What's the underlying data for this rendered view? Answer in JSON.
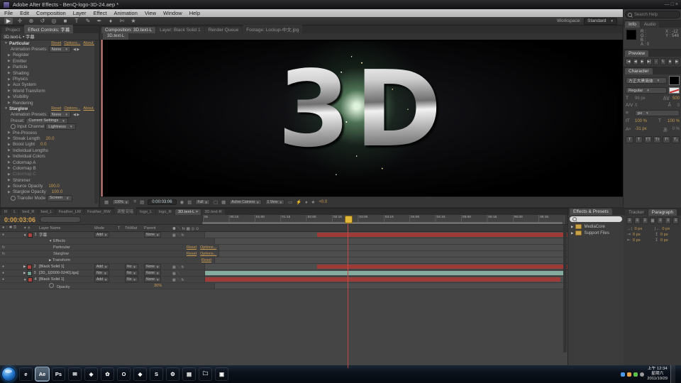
{
  "icons": {
    "expander_closed": "▶",
    "expander_open": "▼",
    "caret": "▼",
    "prev_next": "◀ ▶",
    "x_close": "×",
    "lock": "a",
    "eye": "●",
    "fx": "fx",
    "plus_target": "+"
  },
  "window": {
    "title": "Adobe After Effects - BenQ-logo-3D-24.aep *",
    "menus": [
      "File",
      "Edit",
      "Composition",
      "Layer",
      "Effect",
      "Animation",
      "View",
      "Window",
      "Help"
    ],
    "win_buttons": "—  □  ×"
  },
  "toolbar": {
    "tools": [
      {
        "g": "▶",
        "cls": "sel"
      },
      {
        "g": "✛"
      },
      {
        "g": "⊕"
      },
      {
        "g": "↺"
      },
      {
        "g": "◎"
      },
      {
        "g": "■"
      },
      {
        "g": "T"
      },
      {
        "g": "✎"
      },
      {
        "g": "✒"
      },
      {
        "g": "♦"
      },
      {
        "g": "✄"
      },
      {
        "g": "★"
      }
    ],
    "workspace_label": "Workspace:",
    "workspace_value": "Standard"
  },
  "search_help": {
    "placeholder": "Search Help"
  },
  "effect_controls": {
    "tabs": [
      {
        "label": "Project"
      },
      {
        "label": "Effect Controls: 字幕",
        "cls": "active"
      }
    ],
    "target": "3D.text-L • 字幕",
    "particular": {
      "name": "Particular",
      "links": [
        "Reset",
        "Options...",
        "About..."
      ],
      "anim_label": "Animation Presets:",
      "anim_value": "None",
      "groups": [
        "Register",
        "Emitter",
        "Particle",
        "Shading",
        "Physics",
        "Aux System",
        "World Transform",
        "Visibility",
        "Rendering"
      ]
    },
    "starglow": {
      "name": "Starglow",
      "links": [
        "Reset",
        "Options...",
        "About..."
      ],
      "anim_label": "Animation Presets:",
      "anim_value": "None",
      "preset_label": "Preset:",
      "preset_value": "Current Settings",
      "input_label": "Input Channel",
      "input_value": "Lightness",
      "rows": [
        {
          "label": "Pre-Process",
          "type": "group"
        },
        {
          "label": "Streak Length",
          "val": "20.0",
          "type": "val"
        },
        {
          "label": "Boost Light",
          "val": "0.0",
          "type": "val"
        },
        {
          "label": "Individual Lengths",
          "type": "group"
        },
        {
          "label": "Individual Colors",
          "type": "group"
        },
        {
          "label": "Colormap A",
          "type": "group"
        },
        {
          "label": "Colormap B",
          "type": "group"
        },
        {
          "label": "Colormap C",
          "type": "group",
          "cls": "dimrow"
        },
        {
          "label": "Shimmer",
          "type": "group"
        },
        {
          "label": "Source Opacity",
          "val": "100.0",
          "type": "val"
        },
        {
          "label": "Starglow Opacity",
          "val": "100.0",
          "type": "val"
        }
      ],
      "transfer_label": "Transfer Mode",
      "transfer_value": "Screen"
    }
  },
  "composition": {
    "tabs": [
      {
        "label": "Composition: 3D.text-L",
        "cls": "active"
      },
      {
        "label": "Layer: Black Solid 1"
      },
      {
        "label": "Render Queue"
      },
      {
        "label": "Footage: Lockup-中文.jpg"
      }
    ],
    "sub_tab": "3D.text-L",
    "logo_text": "3D",
    "bottom": {
      "zoom": "100%",
      "timecode": "0:00:03:06",
      "resolution": "Full",
      "camera": "Active Camera",
      "views": "1 View",
      "exposure": "+0.0"
    }
  },
  "info": {
    "tabs": [
      {
        "label": "Info",
        "cls": "active"
      },
      {
        "label": "Audio"
      }
    ],
    "r": "R :",
    "g": "G :",
    "b": "B :",
    "a": "A : 0",
    "x": "X : -12",
    "y": "Y : 546"
  },
  "preview": {
    "tab": "Preview",
    "buttons": [
      "|◀",
      "◀",
      "▶",
      "▶|",
      "♪",
      "↻",
      "■",
      "▶"
    ]
  },
  "character": {
    "tab": "Character",
    "font": "方正大黑简体",
    "style": "Regular",
    "size": "96 px",
    "kerning": "0",
    "tracking": "500",
    "leading": "0",
    "vertical_scale": "100 %",
    "horizontal_scale": "100 %",
    "baseline_shift": "-31 px",
    "tsume": "0 %",
    "toggles": [
      "T",
      "T",
      "TT",
      "Tт",
      "T¹",
      "T₁"
    ]
  },
  "paragraph": {
    "tabs": [
      {
        "label": "Tracker"
      },
      {
        "label": "Paragraph",
        "cls": "active"
      }
    ],
    "aligns": [
      "≡",
      "≡",
      "≡",
      "≣",
      "≡",
      "≡",
      "≡"
    ],
    "fields": [
      {
        "icon": "→|",
        "val": "0 px"
      },
      {
        "icon": "|←",
        "val": "0 px"
      },
      {
        "icon": "⇥",
        "val": "0 px"
      },
      {
        "icon": "↥",
        "val": "0 px"
      },
      {
        "icon": "⇤",
        "val": "0 px"
      },
      {
        "icon": "↧",
        "val": "0 px"
      }
    ]
  },
  "fx_presets": {
    "tab": "Effects & Presets",
    "items": [
      "MediaCore",
      "Support Files"
    ]
  },
  "timeline": {
    "tabs": [
      {
        "label": "R"
      },
      {
        "label": "L"
      },
      {
        "label": "bed_R"
      },
      {
        "label": "bed_L"
      },
      {
        "label": "Feather_LW"
      },
      {
        "label": "Feather_RW"
      },
      {
        "label": "调整变暗"
      },
      {
        "label": "logo_L"
      },
      {
        "label": "logo_R"
      },
      {
        "label": "3D.text-L ×",
        "cls": "active"
      },
      {
        "label": "3D.text-R"
      }
    ],
    "timecode": "0:00:03:06",
    "cols": {
      "name": "Layer Name",
      "mode": "Mode",
      "t": "T",
      "trkmat": "TrkMat",
      "parent": "Parent"
    },
    "ruler": [
      "0s",
      "00:15",
      "01:00",
      "01:15",
      "02:00",
      "02:15",
      "03:00",
      "03:15",
      "04:00",
      "04:15",
      "05:00",
      "05:15",
      "06:00",
      "06:15"
    ],
    "rows": {
      "l1": {
        "num": "1",
        "name": "字幕",
        "mode": "Add",
        "parent": "None"
      },
      "effects": "Effects",
      "particular": {
        "name": "Particular",
        "links": [
          "Reset",
          "Options..."
        ]
      },
      "starglow": {
        "name": "Starglow",
        "links": [
          "Reset",
          "Options..."
        ]
      },
      "transform": {
        "name": "Transform",
        "links": [
          "Reset"
        ]
      },
      "l2": {
        "num": "2",
        "name": "[Black Solid 1]",
        "mode": "Add",
        "trk": "No",
        "parent": "None"
      },
      "l3": {
        "num": "3",
        "name": "[3D_1[0000-0240].tga]",
        "mode": "Nor",
        "trk": "No",
        "parent": "None"
      },
      "l4": {
        "num": "4",
        "name": "[Black Solid 1]",
        "mode": "Add",
        "trk": "No",
        "parent": "None"
      },
      "opacity": {
        "name": "Opacity",
        "val": "30%"
      }
    },
    "colors": {
      "red_bar": "#9c3b38",
      "teal_bar": "#86ab9f",
      "label_red": "#b0453f",
      "label_teal": "#6fa092"
    }
  },
  "taskbar": {
    "apps": [
      {
        "label": "e",
        "bg": "linear-gradient(#4aa3e8,#1565b8)"
      },
      {
        "label": "Ae",
        "bg": "linear-gradient(#4a4660,#262338)",
        "cls": "active"
      },
      {
        "label": "Ps",
        "bg": "linear-gradient(#2c4a66,#12283e)"
      },
      {
        "label": "✉",
        "bg": "linear-gradient(#e8b24a,#b07618)"
      },
      {
        "label": "◈",
        "bg": "linear-gradient(#5a5a5a,#2c2c2c)"
      },
      {
        "label": "✿",
        "bg": "linear-gradient(#6cc24a,#2c7a18)"
      },
      {
        "label": "O",
        "bg": "linear-gradient(#e88a3a,#b84a12)"
      },
      {
        "label": "◆",
        "bg": "linear-gradient(#8a4ae8,#4a18a8)"
      },
      {
        "label": "S",
        "bg": "linear-gradient(#4ab8e8,#1276b8)"
      },
      {
        "label": "⚙",
        "bg": "linear-gradient(#e8a24a,#b86a12)"
      },
      {
        "label": "▤",
        "bg": "linear-gradient(#d84a4a,#3a5ab8)"
      },
      {
        "label": "🗀",
        "bg": "linear-gradient(#e8d24a,#b89a2a)"
      },
      {
        "label": "▣",
        "bg": "linear-gradient(#4a6ae8,#1838a8)"
      }
    ],
    "tray_time": "上午 12:34",
    "tray_day": "星期六",
    "tray_date": "2011/10/29"
  }
}
